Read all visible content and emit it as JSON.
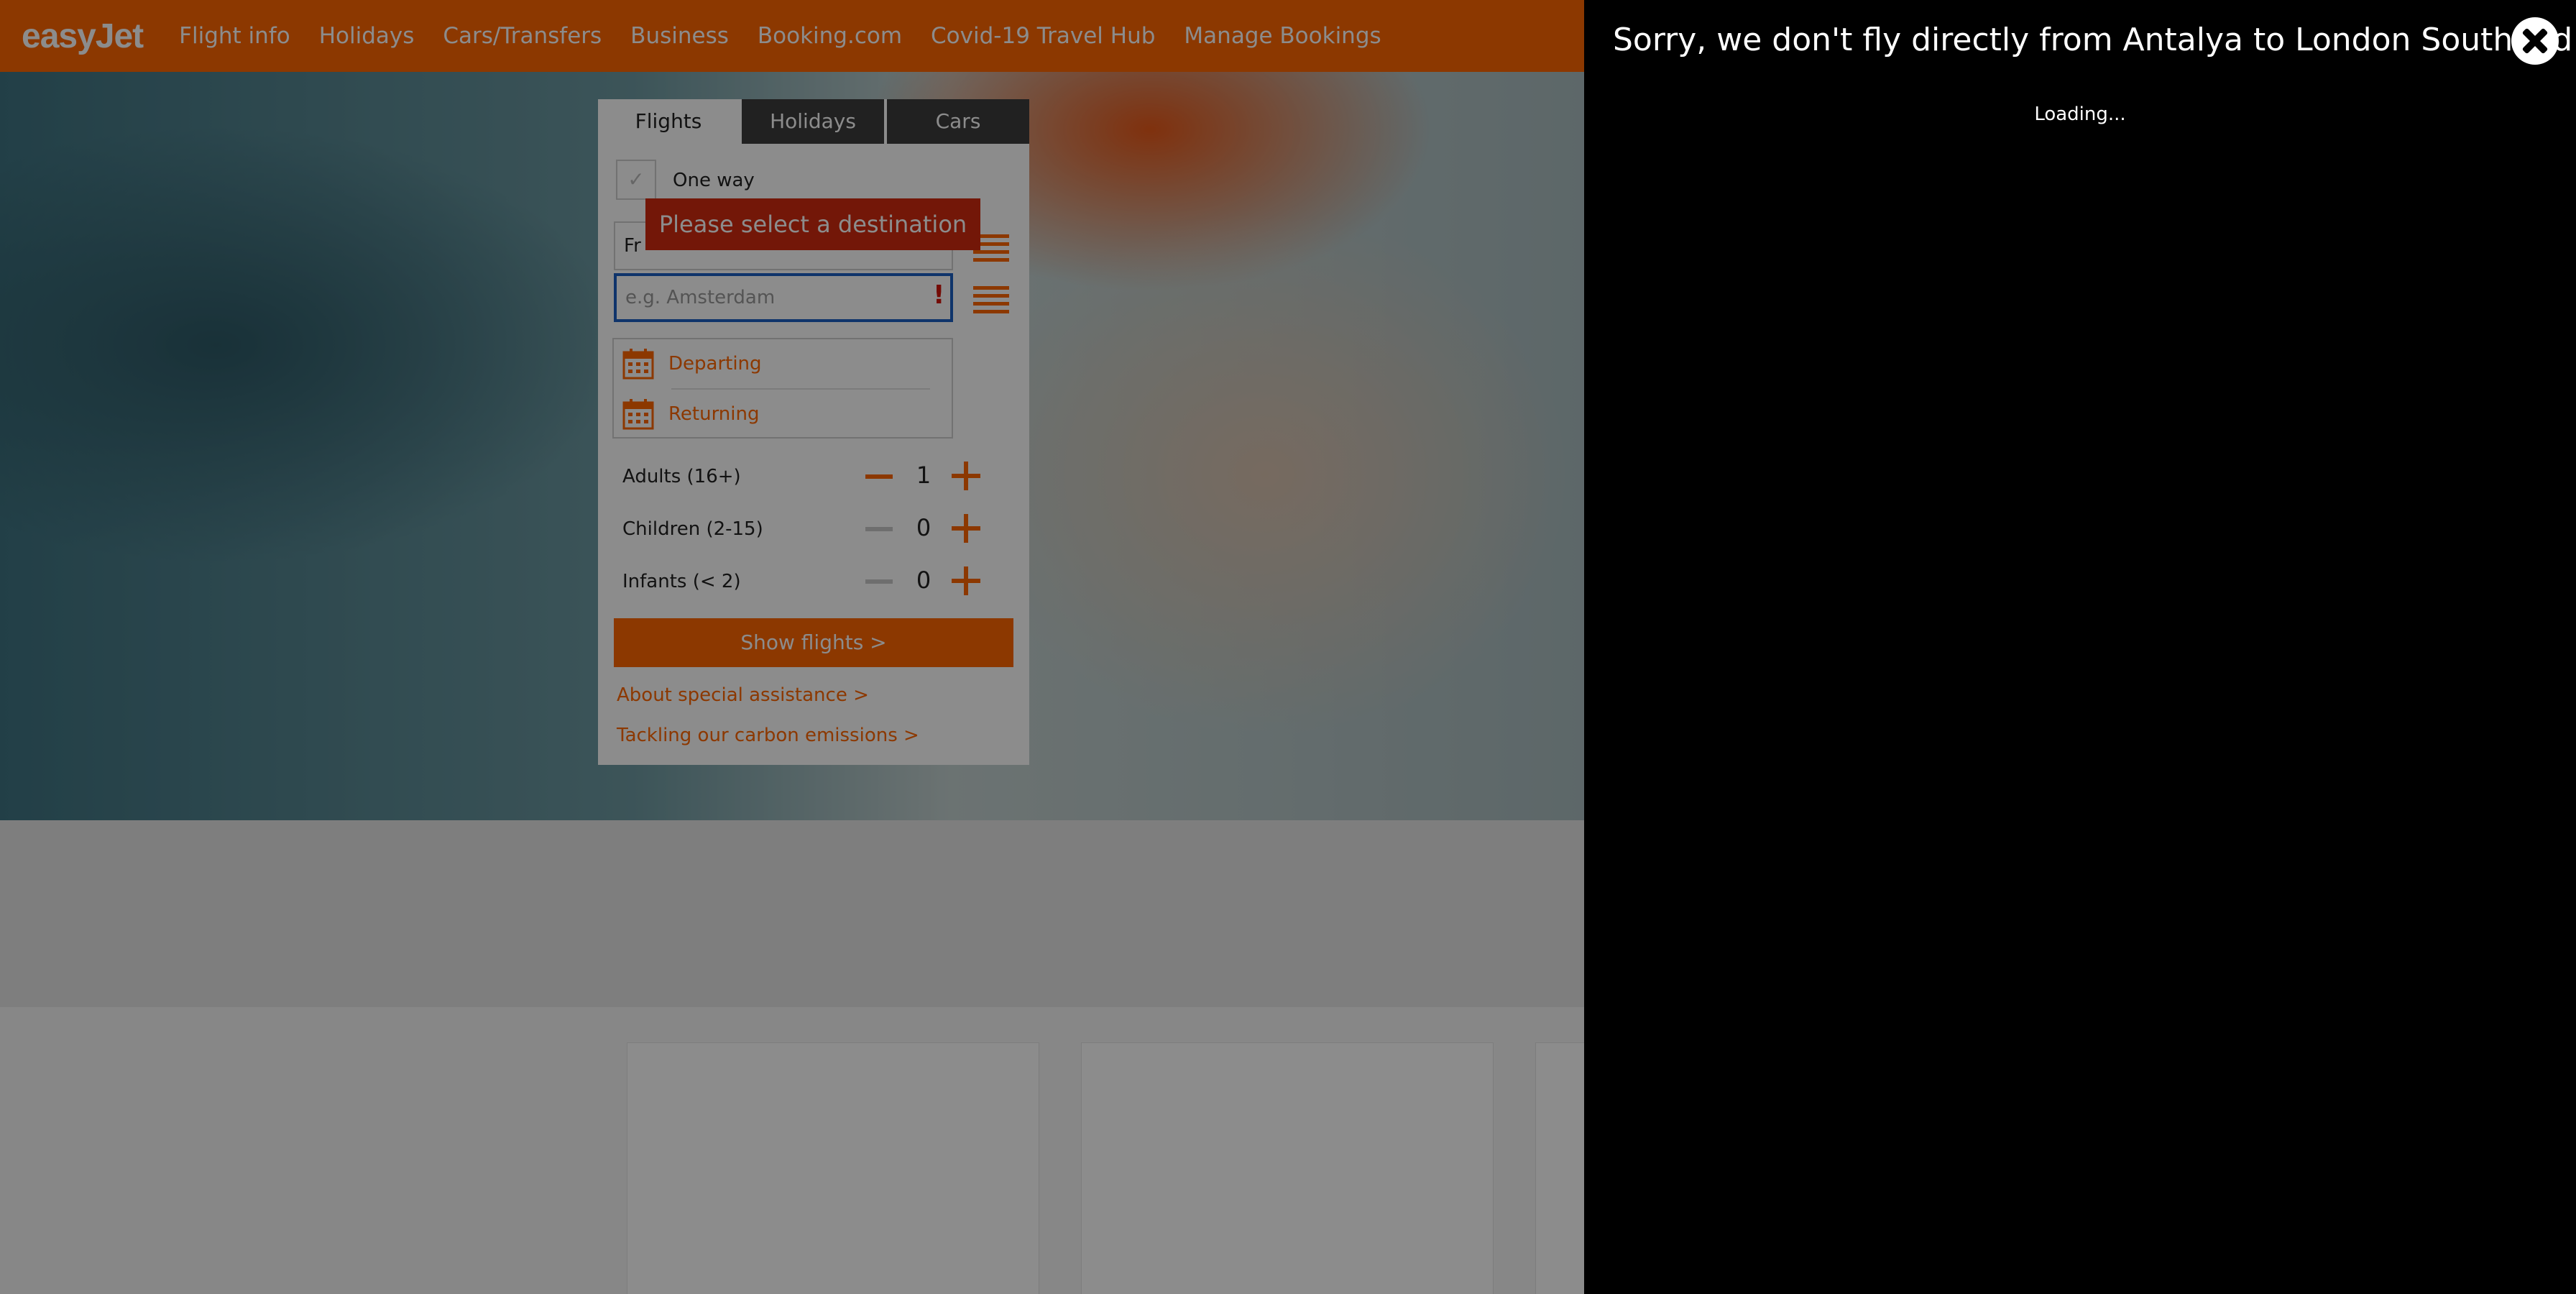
{
  "header": {
    "logo": "easyJet",
    "nav": [
      "Flight info",
      "Holidays",
      "Cars/Transfers",
      "Business",
      "Booking.com",
      "Covid-19 Travel Hub",
      "Manage Bookings"
    ]
  },
  "widget": {
    "tabs": [
      "Flights",
      "Holidays",
      "Cars"
    ],
    "active_tab": "Flights",
    "one_way_label": "One way",
    "from_value": "Fr",
    "to_placeholder": "e.g. Amsterdam",
    "error_message": "Please select a destination",
    "error_mark": "!",
    "departing_label": "Departing",
    "returning_label": "Returning",
    "passengers": [
      {
        "label": "Adults (16+)",
        "count": "1"
      },
      {
        "label": "Children (2-15)",
        "count": "0"
      },
      {
        "label": "Infants (< 2)",
        "count": "0"
      }
    ],
    "show_flights_label": "Show flights >",
    "links": [
      "About special assistance >",
      "Tackling our carbon emissions >"
    ]
  },
  "modal": {
    "title": "Sorry, we don't fly directly from Antalya to London Southend",
    "loading_text": "Loading..."
  },
  "colors": {
    "brand_orange": "#ff6600",
    "error_red": "#d22a0f",
    "focus_blue": "#1c5fc4",
    "modal_bg": "#000000"
  }
}
